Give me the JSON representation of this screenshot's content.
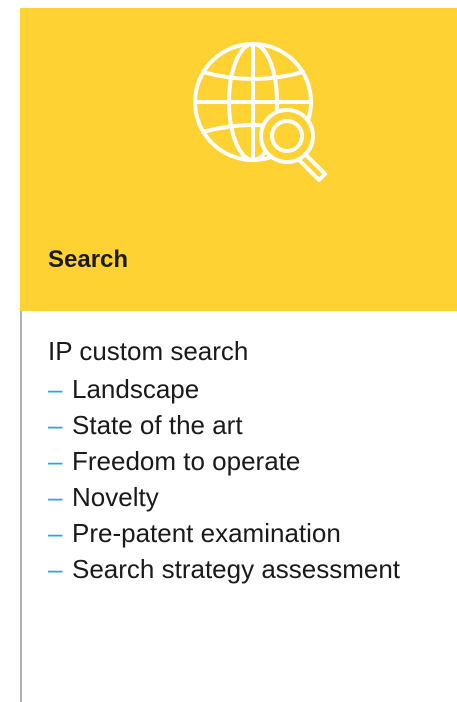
{
  "card": {
    "title": "Search",
    "intro": "IP custom search",
    "items": [
      "Landscape",
      "State of the art",
      "Freedom to operate",
      "Novelty",
      "Pre-patent examination",
      "Search strategy assessment"
    ],
    "bullet": "–",
    "icon": "globe-search-icon"
  },
  "colors": {
    "header_bg": "#FDD232",
    "accent": "#29A8E0",
    "text": "#1A1A1A",
    "rule": "#B3B3B3"
  }
}
